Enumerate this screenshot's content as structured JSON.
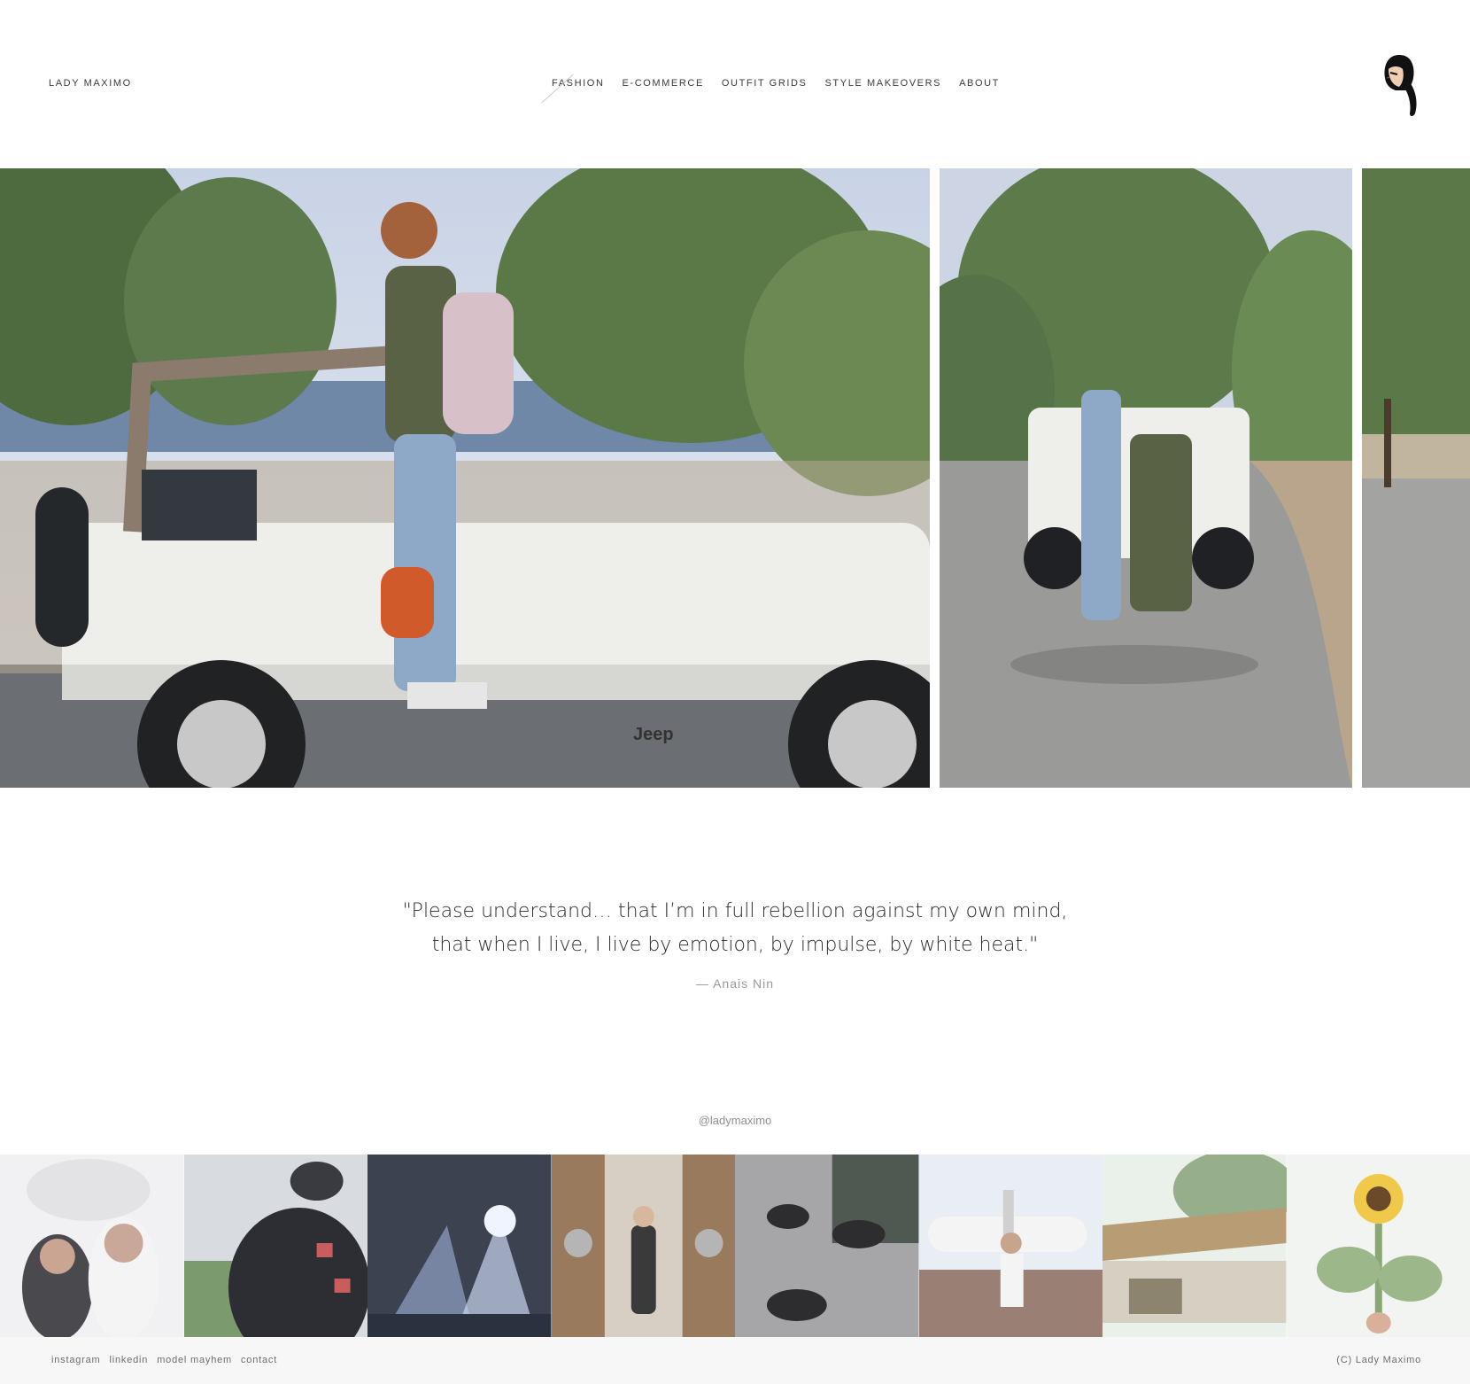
{
  "header": {
    "site_title": "LADY MAXIMO",
    "nav": [
      {
        "label": "FASHION",
        "active": true
      },
      {
        "label": "E-COMMERCE"
      },
      {
        "label": "OUTFIT GRIDS"
      },
      {
        "label": "STYLE MAKEOVERS"
      },
      {
        "label": "ABOUT"
      }
    ],
    "avatar_icon": "girl-avatar-icon"
  },
  "gallery": {
    "slides": [
      {
        "subject": "jeep-side-photo"
      },
      {
        "subject": "couple-on-jeep-photo"
      },
      {
        "subject": "road-partial-photo"
      }
    ]
  },
  "quote": {
    "line1": "\"Please understand… that I’m in full rebellion against my own mind,",
    "line2": "that when I live, I live by emotion, by impulse, by white heat.\"",
    "author": "— Anais Nin"
  },
  "instagram": {
    "handle": "@ladymaximo",
    "tiles": [
      "mosque-selfie",
      "leather-jacket",
      "concert-lights",
      "laundromat-door",
      "sneakers-feet",
      "airplane-field",
      "palm-hut",
      "sunflower"
    ]
  },
  "footer": {
    "links": [
      "instagram",
      "linkedin",
      "model mayhem",
      "contact"
    ],
    "copyright": "(C) Lady Maximo"
  },
  "colors": {
    "background": "#ffffff",
    "text": "#2b2b2b",
    "muted": "#9a9a9a",
    "footer_bg": "#f7f7f7"
  }
}
